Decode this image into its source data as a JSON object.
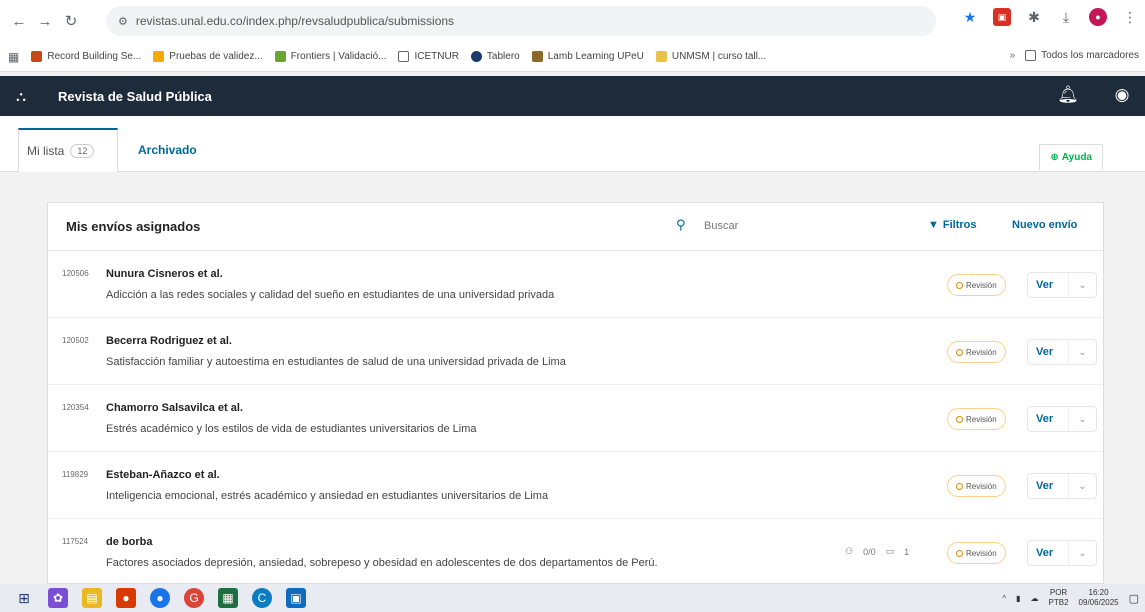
{
  "browser": {
    "url": "revistas.unal.edu.co/index.php/revsaludpublica/submissions",
    "bookmarks": [
      {
        "label": "Record Building Se...",
        "color": "#c9461b"
      },
      {
        "label": "Pruebas de validez...",
        "color": "#f2a900"
      },
      {
        "label": "Frontiers | Validació...",
        "color": "#6aa62e"
      },
      {
        "label": "ICETNUR",
        "color": "#666666"
      },
      {
        "label": "Tablero",
        "color": "#1a3a6e"
      },
      {
        "label": "Lamb Learning UPeU",
        "color": "#8a6a2a"
      },
      {
        "label": "UNMSM | curso tall...",
        "color": "#e8c24a"
      }
    ],
    "bookmarks_other": "Todos los marcadores"
  },
  "header": {
    "journal_title": "Revista de Salud Pública"
  },
  "tabs": {
    "my_list": "Mi lista",
    "my_list_count": "12",
    "archived": "Archivado",
    "help": "Ayuda"
  },
  "panel": {
    "title": "Mis envíos asignados",
    "search_placeholder": "Buscar",
    "filters_label": "Filtros",
    "new_submission_label": "Nuevo envío"
  },
  "submissions": [
    {
      "id": "120506",
      "author": "Nunura Cisneros et al.",
      "title": "Adicción a las redes sociales y calidad del sueño en estudiantes de una universidad privada",
      "status": "Revisión",
      "action": "Ver"
    },
    {
      "id": "120502",
      "author": "Becerra Rodriguez et al.",
      "title": "Satisfacción familiar y autoestima en estudiantes de salud de una universidad privada de Lima",
      "status": "Revisión",
      "action": "Ver"
    },
    {
      "id": "120354",
      "author": "Chamorro Salsavilca et al.",
      "title": "Estrés académico y los estilos de vida de estudiantes universitarios de Lima",
      "status": "Revisión",
      "action": "Ver"
    },
    {
      "id": "119829",
      "author": "Esteban-Añazco et al.",
      "title": "Inteligencia emocional, estrés académico y ansiedad en estudiantes universitarios de Lima",
      "status": "Revisión",
      "action": "Ver"
    },
    {
      "id": "117524",
      "author": "de borba",
      "title": "Factores asociados depresión, ansiedad, sobrepeso y obesidad en adolescentes de dos departamentos de Perú.",
      "status": "Revisión",
      "action": "Ver",
      "reviews": "0/0",
      "discussions": "1"
    }
  ],
  "taskbar": {
    "lang": "POR",
    "lang2": "PTB2",
    "time": "16:20",
    "date": "09/06/2025"
  }
}
